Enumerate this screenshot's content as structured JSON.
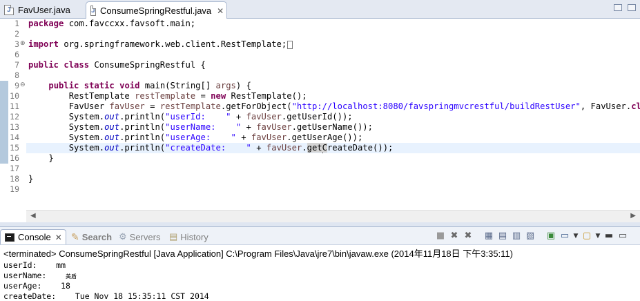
{
  "editor_tabs": [
    {
      "label": "FavUser.java",
      "active": false
    },
    {
      "label": "ConsumeSpringRestful.java",
      "active": true
    }
  ],
  "tab_close_glyph": "✕",
  "line_numbers": [
    "1",
    "2",
    "3",
    "6",
    "7",
    "8",
    "9",
    "10",
    "11",
    "12",
    "13",
    "14",
    "15",
    "16",
    "17",
    "18",
    "19"
  ],
  "code": {
    "l1_kw": "package",
    "l1_rest": " com.favccxx.favsoft.main;",
    "l3_kw": "import",
    "l3_rest": " org.springframework.web.client.RestTemplate;",
    "l7_kw1": "public",
    "l7_kw2": "class",
    "l7_rest": " ConsumeSpringRestful {",
    "l9_indent": "    ",
    "l9_kw1": "public",
    "l9_kw2": "static",
    "l9_kw3": "void",
    "l9_rest1": " main(String[] ",
    "l9_var": "args",
    "l9_rest2": ") {",
    "l10_a": "        RestTemplate ",
    "l10_var": "restTemplate",
    "l10_b": " = ",
    "l10_kw": "new",
    "l10_c": " RestTemplate();",
    "l11_a": "        FavUser ",
    "l11_var1": "favUser",
    "l11_b": " = ",
    "l11_var2": "restTemplate",
    "l11_c": ".getForObject(",
    "l11_str": "\"http://localhost:8080/favspringmvcrestful/buildRestUser\"",
    "l11_d": ", FavUser.",
    "l11_kw": "class",
    "l11_e": ");",
    "l12_a": "        System.",
    "l12_fld": "out",
    "l12_b": ".println(",
    "l12_str": "\"userId:    \"",
    "l12_c": " + ",
    "l12_var": "favUser",
    "l12_d": ".getUserId());",
    "l13_a": "        System.",
    "l13_fld": "out",
    "l13_b": ".println(",
    "l13_str": "\"userName:    \"",
    "l13_c": " + ",
    "l13_var": "favUser",
    "l13_d": ".getUserName());",
    "l14_a": "        System.",
    "l14_fld": "out",
    "l14_b": ".println(",
    "l14_str": "\"userAge:    \"",
    "l14_c": " + ",
    "l14_var": "favUser",
    "l14_d": ".getUserAge());",
    "l15_a": "        System.",
    "l15_fld": "out",
    "l15_b": ".println(",
    "l15_str": "\"createDate:    \"",
    "l15_c": " + ",
    "l15_var": "favUser",
    "l15_d": ".",
    "l15_sel1": "get",
    "l15_sel2": "C",
    "l15_sel3": "reateDate",
    "l15_e": "());",
    "l16": "    }",
    "l18": "}"
  },
  "views": {
    "console": "Console",
    "search": "Search",
    "servers": "Servers",
    "history": "History"
  },
  "console": {
    "terminated": "<terminated> ConsumeSpringRestful [Java Application] C:\\Program Files\\Java\\jre7\\bin\\javaw.exe (2014年11月18日 下午3:35:11)",
    "out1": "userId:    mm",
    "out2_label": "userName:    ",
    "out2_value": "美盾",
    "out3": "userAge:    18",
    "out4": "createDate:    Tue Nov 18 15:35:11 CST 2014"
  },
  "icons": {
    "console_tab": "console-icon",
    "search_tab": "search-icon",
    "servers_tab": "servers-icon",
    "history_tab": "history-icon"
  }
}
